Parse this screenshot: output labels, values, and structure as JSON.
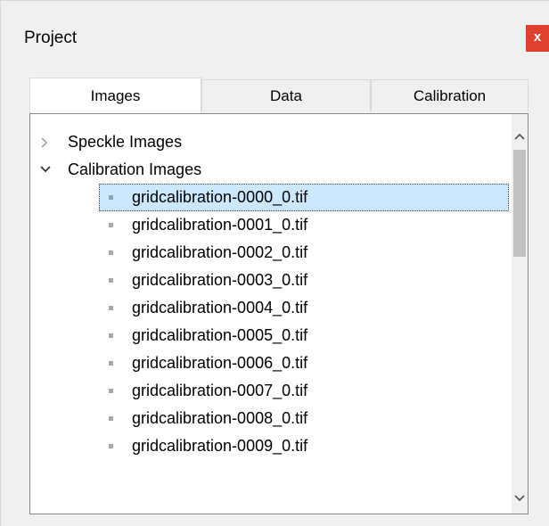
{
  "panel": {
    "title": "Project",
    "close_label": "x",
    "accent_close": "#e0412f"
  },
  "tabs": [
    {
      "label": "Images",
      "active": true
    },
    {
      "label": "Data",
      "active": false
    },
    {
      "label": "Calibration",
      "active": false
    }
  ],
  "tree": {
    "groups": [
      {
        "label": "Speckle Images",
        "expanded": false,
        "icon": "chevron-right-icon"
      },
      {
        "label": "Calibration Images",
        "expanded": true,
        "icon": "chevron-down-icon"
      }
    ],
    "calibration_files": [
      "gridcalibration-0000_0.tif",
      "gridcalibration-0001_0.tif",
      "gridcalibration-0002_0.tif",
      "gridcalibration-0003_0.tif",
      "gridcalibration-0004_0.tif",
      "gridcalibration-0005_0.tif",
      "gridcalibration-0006_0.tif",
      "gridcalibration-0007_0.tif",
      "gridcalibration-0008_0.tif",
      "gridcalibration-0009_0.tif"
    ],
    "selected_file": "gridcalibration-0000_0.tif",
    "selection_color": "#cce8ff"
  }
}
